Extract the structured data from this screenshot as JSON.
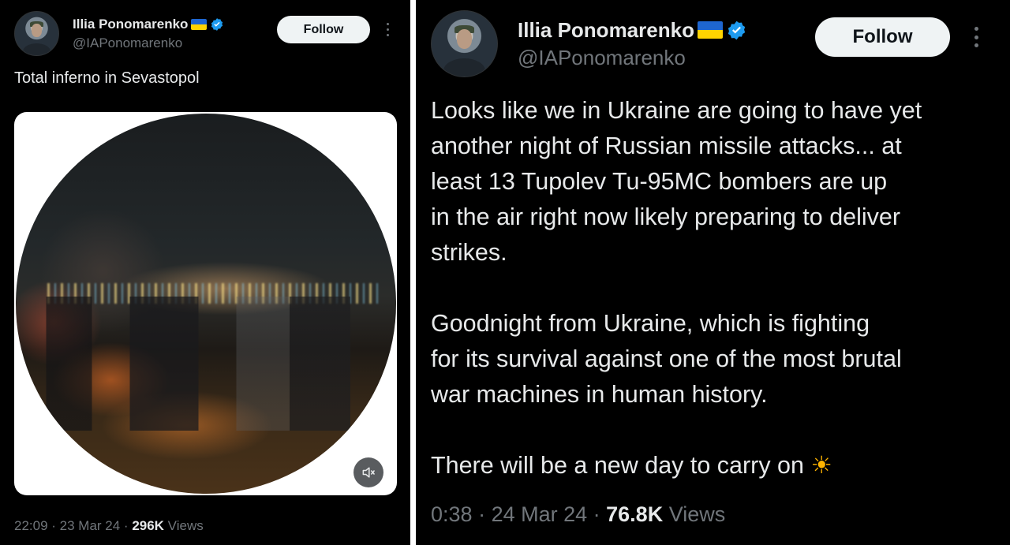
{
  "left_tweet": {
    "author": {
      "name": "Illia Ponomarenko",
      "handle": "@IAPonomarenko"
    },
    "follow_label": "Follow",
    "text": "Total inferno in Sevastopol",
    "meta": {
      "time": "22:09",
      "sep1": " · ",
      "date": "23 Mar 24",
      "sep2": " · ",
      "views_count": "296K",
      "views_label": " Views"
    }
  },
  "right_tweet": {
    "author": {
      "name": "Illia Ponomarenko",
      "handle": "@IAPonomarenko"
    },
    "follow_label": "Follow",
    "text": "Looks like we in Ukraine are going to have yet\nanother night of Russian missile attacks... at\nleast 13 Tupolev Tu-95MC bombers are up\nin the air right now likely preparing to deliver\nstrikes.\n\nGoodnight from Ukraine, which is fighting\nfor its survival against one of the most brutal\nwar machines in human history.\n\nThere will be a new day to carry on ",
    "emoji": "☀",
    "meta": {
      "time": "0:38",
      "sep1": " · ",
      "date": "24 Mar 24",
      "sep2": " · ",
      "views_count": "76.8K",
      "views_label": " Views"
    }
  },
  "colors": {
    "background": "#000000",
    "text": "#e7e9ea",
    "secondary": "#71767b",
    "verified": "#1d9bf0",
    "flag_blue": "#1e66d0",
    "flag_yellow": "#ffd400",
    "follow_bg": "#eff3f4"
  },
  "icons": {
    "verified": "verified-badge-icon",
    "flag": "ukraine-flag-icon",
    "more": "more-options-icon",
    "mute": "muted-speaker-icon"
  }
}
